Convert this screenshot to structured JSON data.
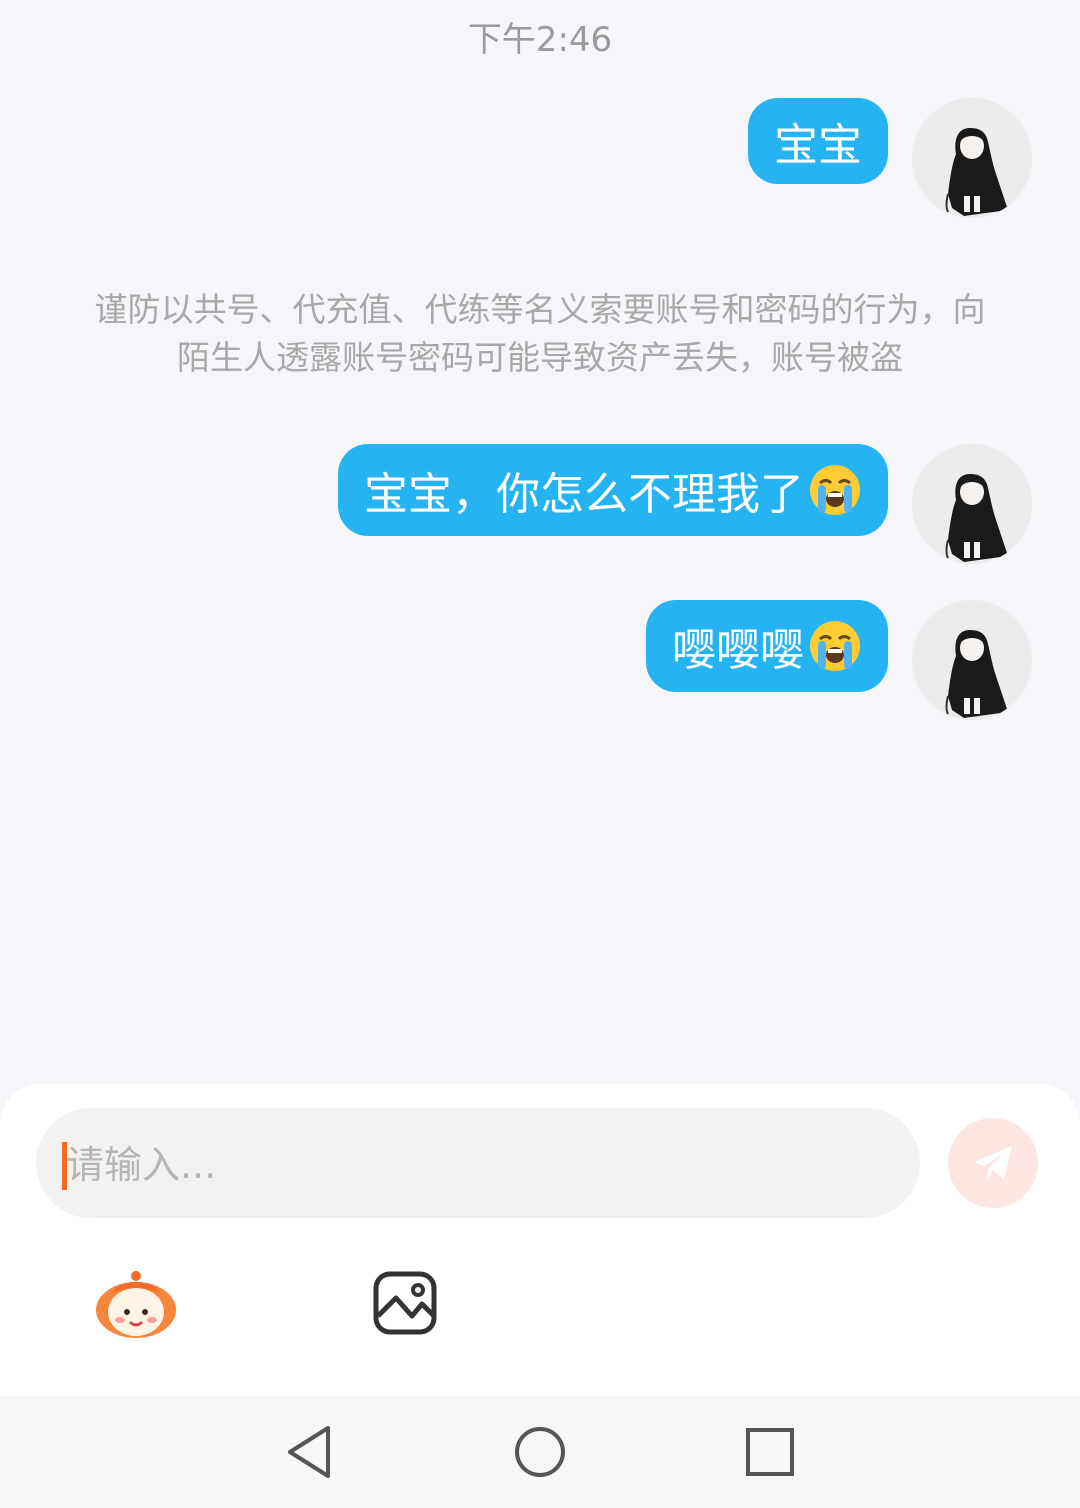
{
  "status": {
    "time": "下午2:46"
  },
  "messages": [
    {
      "text": "宝宝",
      "emoji": ""
    },
    {
      "text": "宝宝，你怎么不理我了",
      "emoji": "loudly-crying-face-emoji"
    },
    {
      "text": "嘤嘤嘤",
      "emoji": "loudly-crying-face-emoji"
    }
  ],
  "notice": {
    "text": "谨防以共号、代充值、代练等名义索要账号和密码的行为，向陌生人透露账号密码可能导致资产丢失，账号被盗"
  },
  "composer": {
    "placeholder": "请输入...",
    "send_icon": "paper-plane-icon",
    "tools": [
      "emoji-sticker-icon",
      "image-picker-icon"
    ]
  },
  "navigation": {
    "buttons": [
      "back-triangle-icon",
      "home-circle-icon",
      "recents-square-icon"
    ]
  },
  "colors": {
    "bubble": "#26b3f2",
    "background": "#f5f6fa",
    "caret": "#f26a1b",
    "send_button": "#fde6e2"
  }
}
